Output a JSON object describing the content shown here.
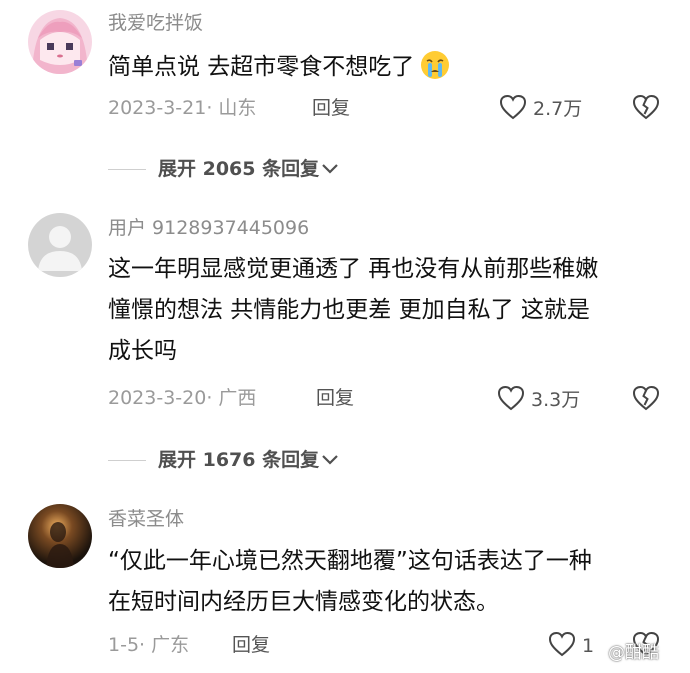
{
  "comments": [
    {
      "username": "我爱吃拌饭",
      "lines": [
        "简单点说 去超市零食不想吃了"
      ],
      "emoji": "crying-face-icon",
      "date_location": "2023-3-21· 山东",
      "reply_label": "回复",
      "like_count": "2.7万",
      "expand_label": "展开 2065 条回复"
    },
    {
      "username": "用户 9128937445096",
      "lines": [
        "这一年明显感觉更通透了 再也没有从前那些稚嫩",
        "憧憬的想法 共情能力也更差 更加自私了 这就是",
        "成长吗"
      ],
      "date_location": "2023-3-20· 广西",
      "reply_label": "回复",
      "like_count": "3.3万",
      "expand_label": "展开 1676 条回复"
    },
    {
      "username": "香菜圣体",
      "lines": [
        "“仅此一年心境已然天翻地覆”这句话表达了一种",
        "在短时间内经历巨大情感变化的状态。"
      ],
      "date_location": "1-5· 广东",
      "reply_label": "回复",
      "like_count": "1"
    }
  ],
  "watermark": "@酣酷",
  "colors": {
    "meta_text": "#9a9a9a",
    "username_text": "#8c8c8c",
    "content_text": "#111111",
    "avatar1_bg": "#f5c6d8",
    "avatar2_bg": "#cfcfcf"
  }
}
